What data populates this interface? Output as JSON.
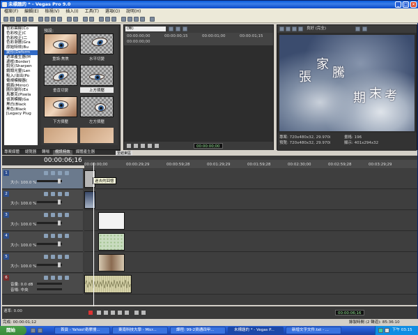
{
  "window": {
    "title": "未標題的 * - Vegas Pro 9.0"
  },
  "menu": [
    "檔案(F)",
    "編輯(E)",
    "檢視(V)",
    "插入(I)",
    "工具(T)",
    "選項(O)",
    "說明(H)"
  ],
  "explorer": {
    "tree": [
      "色彩曲線(Co",
      "色彩校正(C",
      "色彩校正(二",
      "色彩漸層(Gra",
      "原始特效(Bu",
      "變形(Deform",
      "遮罩產生器(M",
      "邊框(Border)",
      "銳化(Sharpen",
      "鏡頭光暈(Len",
      "點入/淡出(Po",
      "電視模擬器(",
      "鏡面(Mirror)",
      "圖形變形(Ex",
      "馬賽克(Pixela",
      "偵測模擬(Ga",
      "黑白(Black",
      "黑色(Black",
      "[Legacy Plug"
    ],
    "tree_selected_index": 5,
    "header": "預設:",
    "thumbs": [
      {
        "label": "重設:焦焦",
        "selected": false
      },
      {
        "label": "水平切變",
        "selected": false
      },
      {
        "label": "垂直切變",
        "selected": false
      },
      {
        "label": "上方擠壓",
        "selected": true
      },
      {
        "label": "下方擠壓",
        "selected": false
      },
      {
        "label": "左方擠壓",
        "selected": false
      }
    ],
    "tabs": [
      "專案媒體",
      "總覽器",
      "轉場",
      "視訊特效",
      "媒體產生器"
    ],
    "active_tab": "視訊特效"
  },
  "trimmer": {
    "dropdown": "(無)",
    "ruler": [
      "00:00:00;00",
      "00:00:00;15",
      "00:00:01;00",
      "00:00:01;15"
    ],
    "in_time": "00:00:00;00",
    "out_time": "00:00:00;00",
    "tc_big": "00:00:00;00"
  },
  "preview": {
    "quality": "良好 (完全)",
    "title_chars": [
      "張",
      "家",
      "騰",
      "期",
      "末",
      "考"
    ],
    "project": "專案: 720x480x32, 29.970i",
    "preview": "預覽: 720x480x32, 29.970i",
    "frame": "畫格: 196",
    "display": "顯示: 401x294x32"
  },
  "timeline": {
    "time": "00:00:06;16",
    "region_label": "至結束區",
    "ruler": [
      "00:00:00;00",
      "00:00:29;29",
      "00:00:59;28",
      "00:01:29;29",
      "00:01:59;28",
      "00:02:30;00",
      "00:02:59;28",
      "00:03:29;29"
    ],
    "tracks": [
      {
        "num": "1",
        "kind": "v",
        "level_label": "大小: 100.0 %",
        "selected": true
      },
      {
        "num": "2",
        "kind": "v",
        "level_label": "大小: 100.0 %",
        "selected": false
      },
      {
        "num": "3",
        "kind": "v",
        "level_label": "大小: 100.0 %",
        "selected": false
      },
      {
        "num": "4",
        "kind": "v",
        "level_label": "大小: 100.0 %",
        "selected": false
      },
      {
        "num": "5",
        "kind": "v",
        "level_label": "大小: 100.0 %",
        "selected": false
      },
      {
        "num": "6",
        "kind": "a",
        "level_label": "音量: 0.0 dB",
        "pan_label": "音場: 中央",
        "selected": false
      }
    ],
    "clip_tooltip": "過去的回憶",
    "rate": "速率: 0.00",
    "footer_time": "00:00:06;16"
  },
  "status": {
    "left": "完成: 00:00:01;12",
    "right_time": "錄製時間 (2 聲道): 85:36:10"
  },
  "taskbar": {
    "start": "開始",
    "tasks": [
      "首頁 - Yahoo!奇摩搜...",
      "東南科技大學 - Micr...",
      "課程: 99-2資通四甲...",
      "未標題的 * - Vegas P...",
      "新增文字文件.txt - ..."
    ],
    "active_task": 3,
    "clock": "下午 03:15"
  }
}
